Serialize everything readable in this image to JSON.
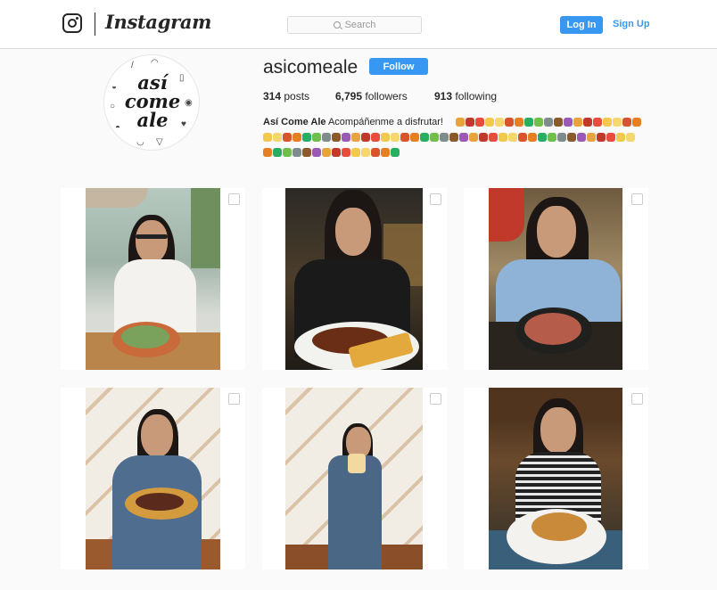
{
  "nav": {
    "wordmark": "Instagram",
    "search_placeholder": "Search",
    "login_label": "Log In",
    "signup_label": "Sign Up"
  },
  "profile": {
    "avatar_text_lines": [
      "así",
      "come",
      "ale"
    ],
    "username": "asicomeale",
    "follow_label": "Follow",
    "stats": {
      "posts_count": "314",
      "posts_label": "posts",
      "followers_count": "6,795",
      "followers_label": "followers",
      "following_count": "913",
      "following_label": "following"
    },
    "bio_name": "Así Come Ale",
    "bio_text": "Acompáñenme a disfrutar!"
  },
  "colors": {
    "accent": "#3897f0",
    "background": "#fafafa",
    "border": "#dbdbdb"
  },
  "icons": [
    "instagram-camera-icon",
    "search-icon"
  ],
  "posts": [
    {
      "alt": "post-1"
    },
    {
      "alt": "post-2"
    },
    {
      "alt": "post-3"
    },
    {
      "alt": "post-4"
    },
    {
      "alt": "post-5"
    },
    {
      "alt": "post-6"
    }
  ]
}
